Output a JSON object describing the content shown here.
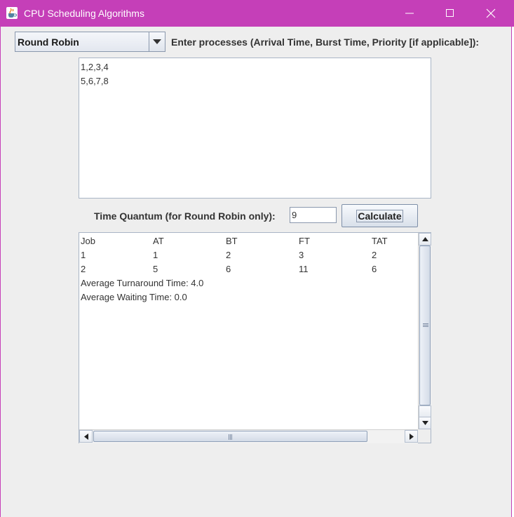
{
  "window": {
    "title": "CPU Scheduling Algorithms",
    "accent_color": "#c53fb8",
    "controls": [
      "minimize-icon",
      "maximize-icon",
      "close-icon"
    ]
  },
  "algorithm_select": {
    "selected": "Round Robin"
  },
  "prompt_label": "Enter processes (Arrival Time, Burst Time, Priority [if applicable]):",
  "processes_input": {
    "lines": [
      "1,2,3,4",
      "5,6,7,8"
    ]
  },
  "quantum": {
    "label": "Time Quantum (for Round Robin only):",
    "value": "9"
  },
  "calculate_button": {
    "label": "Calculate"
  },
  "output": {
    "headers": [
      "Job",
      "AT",
      "BT",
      "FT",
      "TAT"
    ],
    "rows": [
      [
        "1",
        "1",
        "2",
        "3",
        "2"
      ],
      [
        "2",
        "5",
        "6",
        "11",
        "6"
      ]
    ],
    "avg_turnaround": "Average Turnaround Time: 4.0",
    "avg_waiting": "Average Waiting Time: 0.0"
  }
}
